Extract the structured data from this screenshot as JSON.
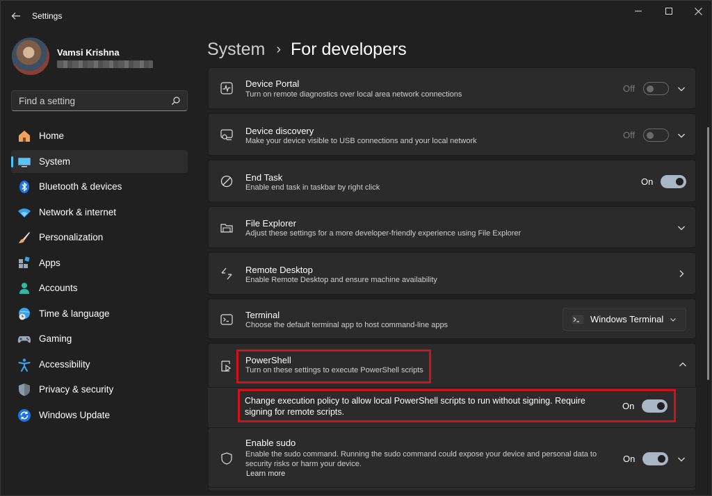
{
  "app": {
    "title": "Settings"
  },
  "profile": {
    "name": "Vamsi Krishna"
  },
  "search": {
    "placeholder": "Find a setting"
  },
  "sidebar": {
    "items": [
      {
        "label": "Home",
        "icon": "home-icon"
      },
      {
        "label": "System",
        "icon": "system-icon",
        "active": true
      },
      {
        "label": "Bluetooth & devices",
        "icon": "bluetooth-icon"
      },
      {
        "label": "Network & internet",
        "icon": "wifi-icon"
      },
      {
        "label": "Personalization",
        "icon": "brush-icon"
      },
      {
        "label": "Apps",
        "icon": "apps-icon"
      },
      {
        "label": "Accounts",
        "icon": "person-icon"
      },
      {
        "label": "Time & language",
        "icon": "globe-clock-icon"
      },
      {
        "label": "Gaming",
        "icon": "controller-icon"
      },
      {
        "label": "Accessibility",
        "icon": "accessibility-icon"
      },
      {
        "label": "Privacy & security",
        "icon": "shield-icon"
      },
      {
        "label": "Windows Update",
        "icon": "update-icon"
      }
    ]
  },
  "header": {
    "parent": "System",
    "separator": "›",
    "current": "For developers"
  },
  "settings": {
    "device_portal": {
      "title": "Device Portal",
      "desc": "Turn on remote diagnostics over local area network connections",
      "state": "Off",
      "on": false
    },
    "device_discovery": {
      "title": "Device discovery",
      "desc": "Make your device visible to USB connections and your local network",
      "state": "Off",
      "on": false
    },
    "end_task": {
      "title": "End Task",
      "desc": "Enable end task in taskbar by right click",
      "state": "On",
      "on": true
    },
    "file_explorer": {
      "title": "File Explorer",
      "desc": "Adjust these settings for a more developer-friendly experience using File Explorer"
    },
    "remote_desktop": {
      "title": "Remote Desktop",
      "desc": "Enable Remote Desktop and ensure machine availability"
    },
    "terminal": {
      "title": "Terminal",
      "desc": "Choose the default terminal app to host command-line apps",
      "selected": "Windows Terminal"
    },
    "powershell": {
      "title": "PowerShell",
      "desc": "Turn on these settings to execute PowerShell scripts",
      "execution_policy": {
        "text": "Change execution policy to allow local PowerShell scripts to run without signing. Require signing for remote scripts.",
        "state": "On",
        "on": true
      }
    },
    "sudo": {
      "title": "Enable sudo",
      "desc": "Enable the sudo command. Running the sudo command could expose your device and personal data to security risks or harm your device.",
      "learn_more": "Learn more",
      "state": "On",
      "on": true
    }
  },
  "colors": {
    "accent": "#4cc2ff",
    "highlight": "#d1111c",
    "toggle_on": "#a8b6c5"
  }
}
